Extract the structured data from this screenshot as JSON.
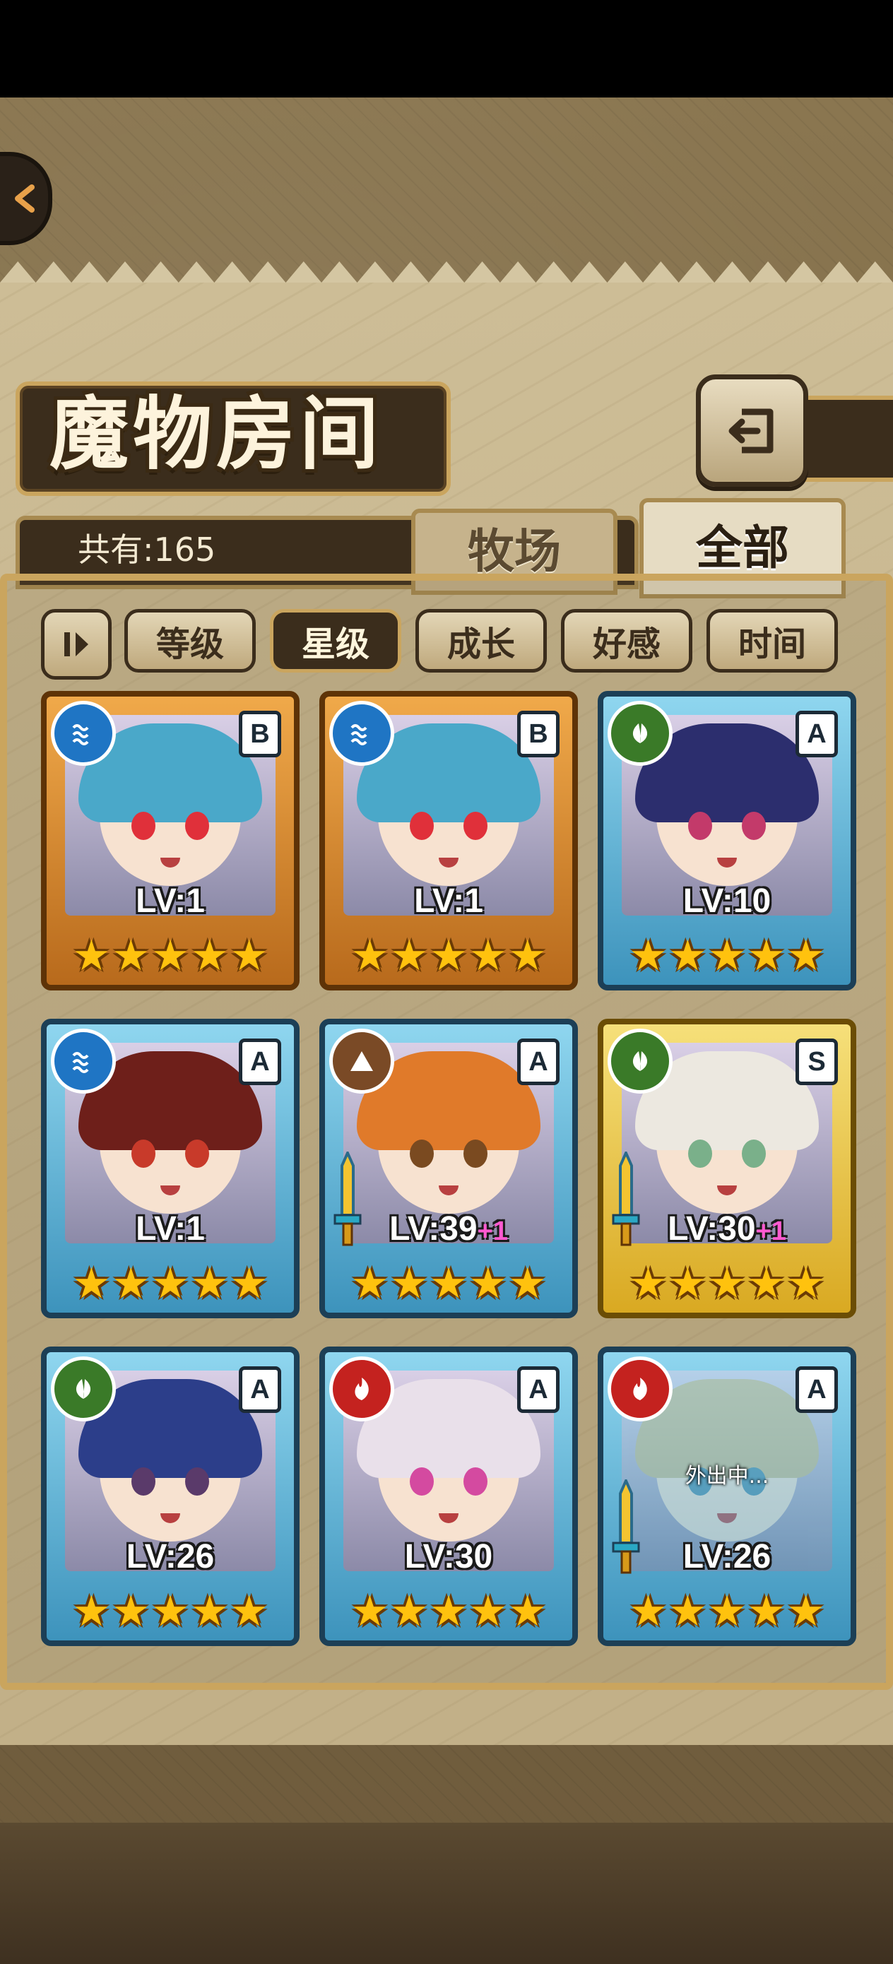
{
  "header": {
    "title": "魔物房间",
    "count_label": "共有:165"
  },
  "tabs": [
    {
      "label": "牧场",
      "active": false
    },
    {
      "label": "全部",
      "active": true
    }
  ],
  "sort": {
    "buttons": [
      {
        "label": "等级",
        "active": false
      },
      {
        "label": "星级",
        "active": true
      },
      {
        "label": "成长",
        "active": false
      },
      {
        "label": "好感",
        "active": false
      },
      {
        "label": "时间",
        "active": false
      }
    ]
  },
  "colors": {
    "water": "#1f75c4",
    "wood": "#3a7a28",
    "earth": "#7a4a26",
    "fire": "#c4221f",
    "star": "#ffc20e",
    "bonus": "#ff5ad0"
  },
  "cards": [
    {
      "element": "water",
      "element_icon": "water-wave-icon",
      "rank": "B",
      "level": "LV:1",
      "bonus": "",
      "stars": 5,
      "equipped": false,
      "status": ""
    },
    {
      "element": "water",
      "element_icon": "water-wave-icon",
      "rank": "B",
      "level": "LV:1",
      "bonus": "",
      "stars": 5,
      "equipped": false,
      "status": ""
    },
    {
      "element": "wood",
      "element_icon": "leaf-icon",
      "rank": "A",
      "level": "LV:10",
      "bonus": "",
      "stars": 5,
      "equipped": false,
      "status": ""
    },
    {
      "element": "water",
      "element_icon": "water-wave-icon",
      "rank": "A",
      "level": "LV:1",
      "bonus": "",
      "stars": 5,
      "equipped": false,
      "status": ""
    },
    {
      "element": "earth",
      "element_icon": "mountain-icon",
      "rank": "A",
      "level": "LV:39",
      "bonus": "+1",
      "stars": 5,
      "equipped": true,
      "status": ""
    },
    {
      "element": "wood",
      "element_icon": "leaf-icon",
      "rank": "S",
      "level": "LV:30",
      "bonus": "+1",
      "stars": 5,
      "equipped": true,
      "status": ""
    },
    {
      "element": "wood",
      "element_icon": "leaf-icon",
      "rank": "A",
      "level": "LV:26",
      "bonus": "",
      "stars": 5,
      "equipped": false,
      "status": ""
    },
    {
      "element": "fire",
      "element_icon": "flame-icon",
      "rank": "A",
      "level": "LV:30",
      "bonus": "",
      "stars": 5,
      "equipped": false,
      "status": ""
    },
    {
      "element": "fire",
      "element_icon": "flame-icon",
      "rank": "A",
      "level": "LV:26",
      "bonus": "",
      "stars": 5,
      "equipped": true,
      "status": "外出中..."
    }
  ]
}
